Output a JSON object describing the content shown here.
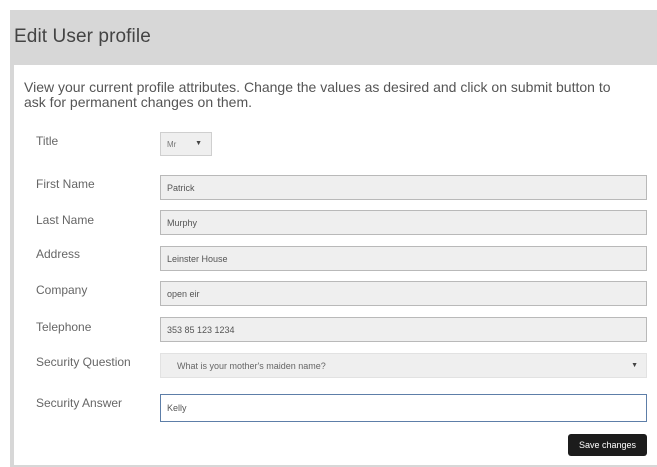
{
  "page": {
    "title": "Edit User profile"
  },
  "intro_text": "View your current profile attributes. Change the values as desired and click on submit button to ask for permanent changes on them.",
  "form": {
    "title": {
      "label": "Title",
      "value": "Mr"
    },
    "first_name": {
      "label": "First Name",
      "value": "Patrick"
    },
    "last_name": {
      "label": "Last Name",
      "value": "Murphy"
    },
    "address": {
      "label": "Address",
      "value": "Leinster House"
    },
    "company": {
      "label": "Company",
      "value": "open eir"
    },
    "telephone": {
      "label": "Telephone",
      "value": "353 85 123 1234"
    },
    "security_question": {
      "label": "Security Question",
      "value": "What is your mother's maiden name?"
    },
    "security_answer": {
      "label": "Security Answer",
      "value": "Kelly"
    }
  },
  "actions": {
    "save_label": "Save changes"
  },
  "icons": {
    "dropdown": "caret-down-icon"
  },
  "colors": {
    "panel_bg": "#d7d7d7",
    "button_bg": "#1c1c1c",
    "active_border": "#5d7ea8"
  }
}
